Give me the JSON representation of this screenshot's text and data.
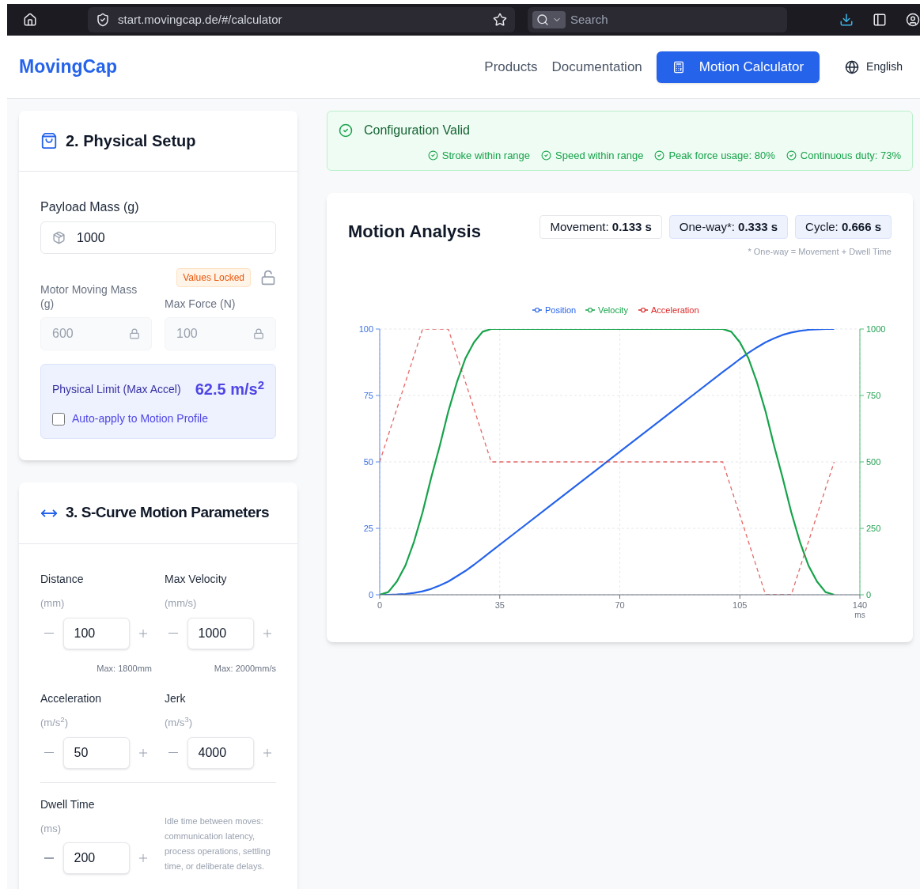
{
  "browser": {
    "url": "start.movingcap.de/#/calculator",
    "search": {
      "placeholder": "Search"
    }
  },
  "header": {
    "logo": "MovingCap",
    "nav": [
      {
        "label": "Products",
        "selected": false
      },
      {
        "label": "Documentation",
        "selected": false
      },
      {
        "label": "Motion Calculator",
        "selected": true
      }
    ],
    "language": "English"
  },
  "physical_setup": {
    "title": "2. Physical Setup",
    "payload": {
      "label": "Payload Mass (g)",
      "value": "1000"
    },
    "lock_badge": "Values Locked",
    "fields": [
      {
        "label": "Motor Moving Mass (g)",
        "value": "600",
        "disabled": true
      },
      {
        "label": "Max Force (N)",
        "value": "100",
        "disabled": true
      }
    ],
    "limit": {
      "label": "Physical Limit (Max Accel)",
      "value": "62.5 m/s$^{2}$",
      "checkbox": {
        "label": "Auto-apply to Motion Profile",
        "checked": false
      }
    }
  },
  "motion_params": {
    "title": "3. S-Curve Motion Parameters",
    "params": [
      {
        "label": "Distance",
        "unit": "(mm)",
        "value": "100",
        "max": "Max: 1800mm"
      },
      {
        "label": "Max Velocity",
        "unit": "(mm/s)",
        "value": "1000",
        "max": "Max: 2000mm/s"
      },
      {
        "label": "Acceleration",
        "unit": "(m/s$^{2}$)",
        "value": "50"
      },
      {
        "label": "Jerk",
        "unit": "(m/s$^{3}$)",
        "value": "4000"
      }
    ],
    "dwell": {
      "label": "Dwell Time",
      "unit": "(ms)",
      "value": "200",
      "note": "Idle time between moves: communication latency, process operations, settling time, or deliberate delays."
    }
  },
  "status": {
    "title": "Configuration Valid",
    "checks": [
      "Stroke within range",
      "Speed within range",
      "Peak force usage: 80%",
      "Continuous duty: 73%"
    ]
  },
  "analysis": {
    "title": "Motion Analysis",
    "badges": [
      {
        "text": "Movement: **0.133 s**",
        "kind": "plain"
      },
      {
        "text": "One-way*: **0.333 s**",
        "kind": "tinted"
      },
      {
        "text": "Cycle: **0.666 s**",
        "kind": "tinted"
      }
    ],
    "footnote": "* One-way = Movement + Dwell Time",
    "chart_data": {
      "type": "line",
      "xlabel": "ms",
      "x": [
        0,
        2.5,
        5,
        7.5,
        10,
        12.5,
        15,
        17.5,
        20,
        22.5,
        25,
        27.5,
        30,
        32.5,
        40,
        50,
        60,
        70,
        80,
        90,
        100,
        102.5,
        105,
        107.5,
        110,
        112.5,
        115,
        117.5,
        120,
        122.5,
        125,
        127.5,
        130,
        132.5
      ],
      "series": [
        {
          "name": "Position",
          "color": "#2563eb",
          "values": [
            0,
            0,
            0.1,
            0.3,
            0.7,
            1.3,
            2.2,
            3.5,
            5,
            7,
            9,
            11.3,
            13.8,
            16.3,
            23.8,
            33.8,
            43.8,
            53.8,
            63.8,
            73.8,
            83.8,
            86.2,
            88.7,
            91,
            93.1,
            95,
            96.5,
            97.8,
            98.7,
            99.3,
            99.7,
            99.9,
            100,
            100
          ]
        },
        {
          "name": "Velocity",
          "color": "#16a34a",
          "axis": "y2",
          "values": [
            0,
            10,
            50,
            110,
            200,
            310,
            440,
            560,
            690,
            800,
            890,
            950,
            990,
            1000,
            1000,
            1000,
            1000,
            1000,
            1000,
            1000,
            1000,
            990,
            950,
            890,
            800,
            690,
            560,
            440,
            310,
            200,
            110,
            50,
            10,
            0
          ]
        },
        {
          "name": "Acceleration",
          "color": "#dc2626",
          "line_style": "dashed",
          "values": [
            50,
            60,
            70,
            80,
            90,
            100,
            100,
            100,
            100,
            90,
            80,
            70,
            60,
            50,
            50,
            50,
            50,
            50,
            50,
            50,
            50,
            40,
            30,
            20,
            10,
            0,
            0,
            0,
            0,
            10,
            20,
            30,
            40,
            50
          ]
        }
      ],
      "grid": true,
      "legend": "top",
      "xlim": [
        0,
        140
      ],
      "xticks": [
        0,
        35,
        70,
        105,
        140
      ],
      "ylim": [
        0,
        100
      ],
      "yticks": [
        0,
        25,
        50,
        75,
        100
      ],
      "y2lim": [
        0,
        1000
      ],
      "y2ticks": [
        0,
        250,
        500,
        750,
        1000
      ]
    }
  }
}
